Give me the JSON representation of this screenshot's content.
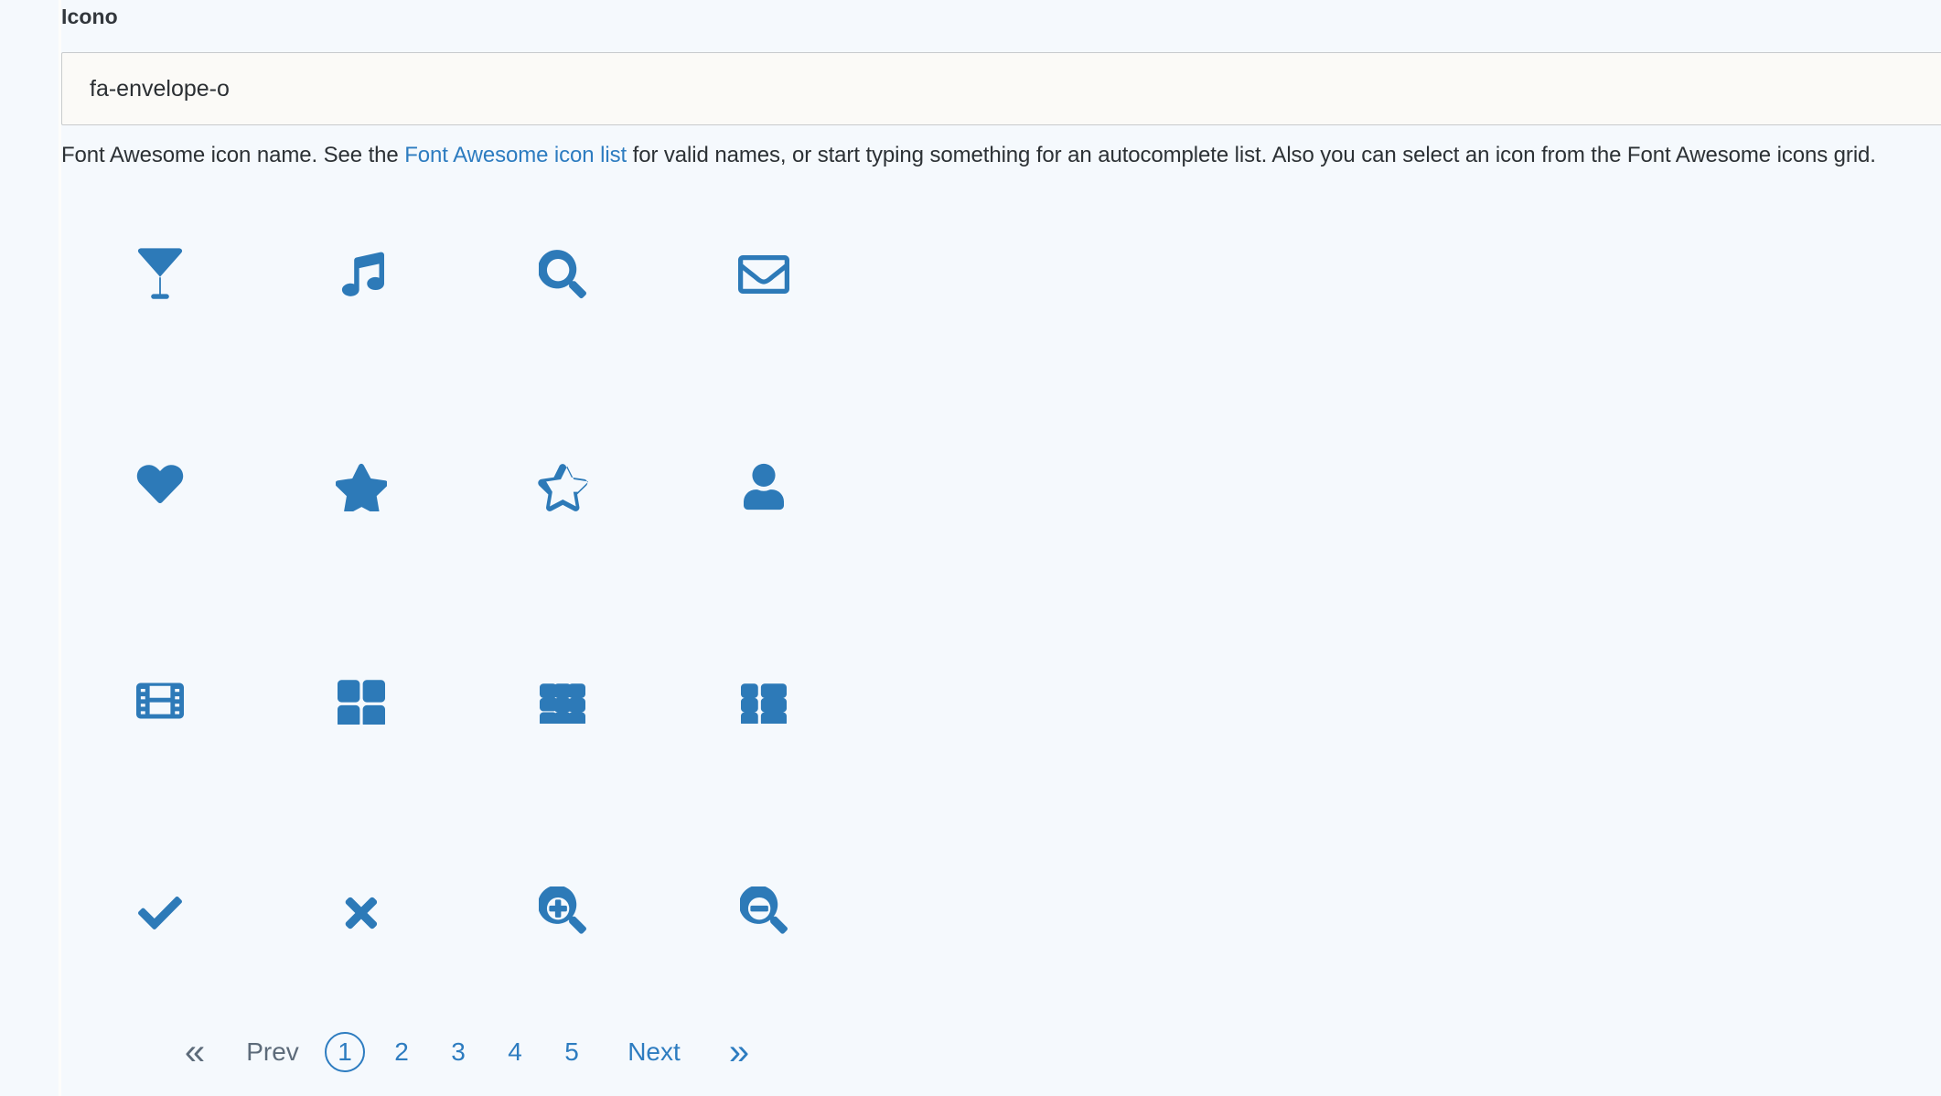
{
  "field": {
    "label": "Icono",
    "value": "fa-envelope-o",
    "placeholder": "fa-envelope-o"
  },
  "help": {
    "before_link": "Font Awesome icon name. See the ",
    "link_text": "Font Awesome icon list",
    "after_link": " for valid names, or start typing something for an autocomplete list. Also you can select an icon from the Font Awesome icons grid."
  },
  "colors": {
    "accent": "#2d7cc0",
    "icon": "#2d7ab8",
    "muted": "#5d6b7a",
    "background": "#f5f9fd",
    "input_background": "#fbfaf7",
    "input_border": "#c8cbcd",
    "label": "#32373c"
  },
  "icon_grid": {
    "columns": 4,
    "rows": 4,
    "icons": [
      {
        "name": "glass-icon",
        "fa": "fa-glass"
      },
      {
        "name": "music-icon",
        "fa": "fa-music"
      },
      {
        "name": "search-icon",
        "fa": "fa-search"
      },
      {
        "name": "envelope-o-icon",
        "fa": "fa-envelope-o"
      },
      {
        "name": "heart-icon",
        "fa": "fa-heart"
      },
      {
        "name": "star-icon",
        "fa": "fa-star"
      },
      {
        "name": "star-o-icon",
        "fa": "fa-star-o"
      },
      {
        "name": "user-icon",
        "fa": "fa-user"
      },
      {
        "name": "film-icon",
        "fa": "fa-film"
      },
      {
        "name": "th-large-icon",
        "fa": "fa-th-large"
      },
      {
        "name": "th-icon",
        "fa": "fa-th"
      },
      {
        "name": "th-list-icon",
        "fa": "fa-th-list"
      },
      {
        "name": "check-icon",
        "fa": "fa-check"
      },
      {
        "name": "times-icon",
        "fa": "fa-times"
      },
      {
        "name": "search-plus-icon",
        "fa": "fa-search-plus"
      },
      {
        "name": "search-minus-icon",
        "fa": "fa-search-minus"
      }
    ]
  },
  "pagination": {
    "first_label": "«",
    "prev_label": "Prev",
    "pages": [
      "1",
      "2",
      "3",
      "4",
      "5"
    ],
    "current_page": "1",
    "next_label": "Next",
    "last_label": "»"
  }
}
